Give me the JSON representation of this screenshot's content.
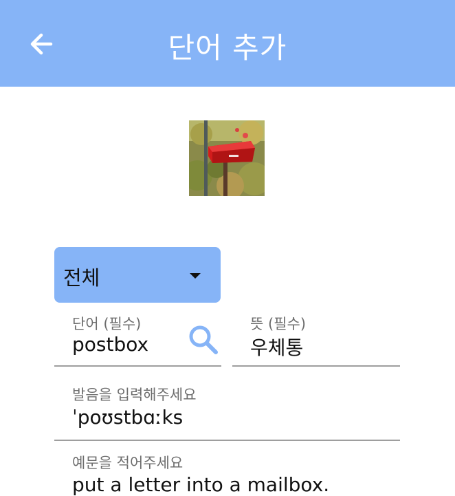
{
  "appbar": {
    "title": "단어 추가",
    "back_icon": "arrow-left-icon",
    "color": "#86b4f7"
  },
  "image": {
    "subject": "red mailbox photo"
  },
  "category": {
    "selected": "전체",
    "icon": "caret-down-icon"
  },
  "word": {
    "label": "단어 (필수)",
    "value": "postbox",
    "search_icon": "search-icon",
    "search_color": "#86b4f7"
  },
  "meaning": {
    "label": "뜻 (필수)",
    "value": "우체통"
  },
  "pronunciation": {
    "label": "발음을 입력해주세요",
    "value": "ˈpoʊstbɑːks"
  },
  "example": {
    "label": "예문을 적어주세요",
    "value": "put a letter into a mailbox."
  }
}
